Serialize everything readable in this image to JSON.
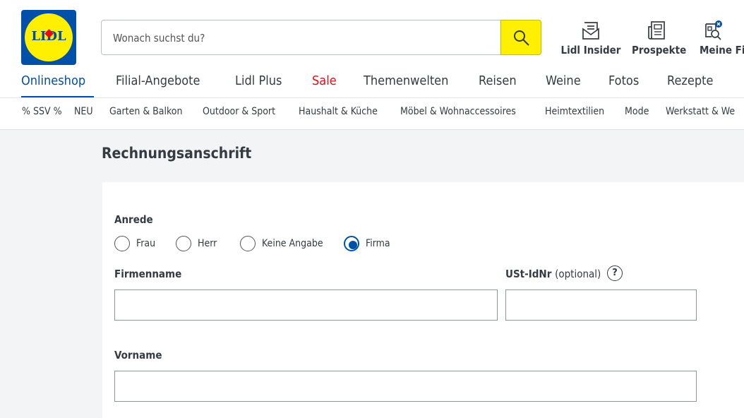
{
  "logo": {
    "text": "LIDL"
  },
  "search": {
    "placeholder": "Wonach suchst du?"
  },
  "header_links": [
    {
      "label": "Lidl Insider",
      "icon": "mail-envelope-icon"
    },
    {
      "label": "Prospekte",
      "icon": "newspaper-icon"
    },
    {
      "label": "Meine Filia",
      "icon": "store-search-icon"
    }
  ],
  "nav": {
    "items": [
      "Onlineshop",
      "Filial-Angebote",
      "Lidl Plus",
      "Sale",
      "Themenwelten",
      "Reisen",
      "Weine",
      "Fotos",
      "Rezepte"
    ],
    "active": "Onlineshop"
  },
  "subnav": {
    "items": [
      "% SSV %",
      "NEU",
      "Garten & Balkon",
      "Outdoor & Sport",
      "Haushalt & Küche",
      "Möbel & Wohnaccessoires",
      "Heimtextilien",
      "Mode",
      "Werkstatt & We"
    ]
  },
  "form": {
    "title": "Rechnungsanschrift",
    "salutation_label": "Anrede",
    "salutation_options": [
      "Frau",
      "Herr",
      "Keine Angabe",
      "Firma"
    ],
    "salutation_selected": "Firma",
    "company_label": "Firmenname",
    "company_value": "",
    "vat_label": "USt-IdNr",
    "vat_optional": "(optional)",
    "vat_help": "?",
    "vat_value": "",
    "firstname_label": "Vorname",
    "firstname_value": ""
  },
  "colors": {
    "brand_blue": "#0050aa",
    "brand_yellow": "#fff000",
    "sale_red": "#e60a14"
  }
}
